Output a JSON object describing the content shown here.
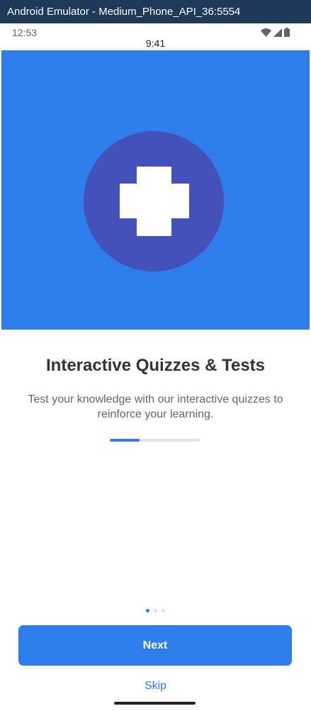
{
  "window": {
    "title": "Android Emulator - Medium_Phone_API_36:5554"
  },
  "status_bar": {
    "time": "12:53",
    "icons": [
      "wifi-icon",
      "cellular-signal-icon",
      "battery-icon"
    ]
  },
  "app_header": {
    "time": "9:41"
  },
  "onboarding": {
    "hero_icon": "plus-cross-icon",
    "title": "Interactive Quizzes & Tests",
    "description": "Test your knowledge with our interactive quizzes to reinforce your learning.",
    "progress": 0.33,
    "page_index": 1,
    "page_count": 3
  },
  "actions": {
    "next_label": "Next",
    "skip_label": "Skip"
  },
  "colors": {
    "accent": "#2f7ded",
    "hero_circle": "#4451bb",
    "title_bar": "#1e3a5a"
  }
}
